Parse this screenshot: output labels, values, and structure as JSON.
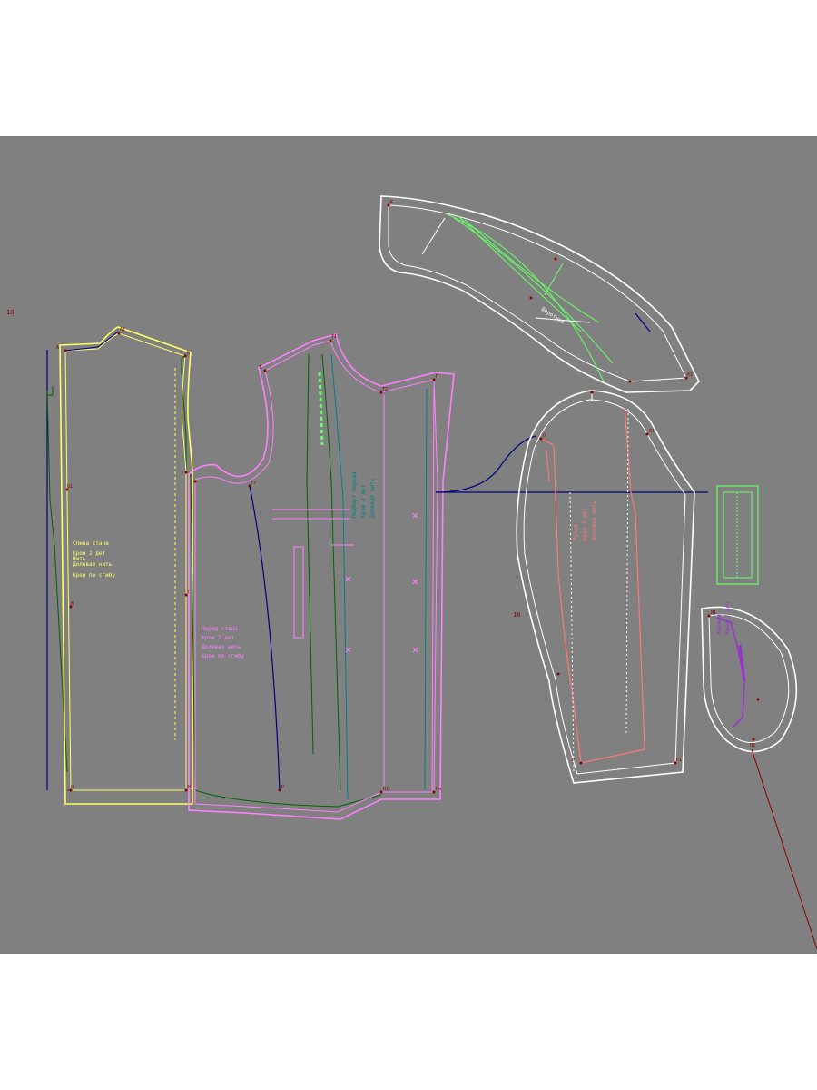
{
  "canvas": {
    "background": "#808080",
    "corner_label": "10",
    "sleeve_side_label": "10"
  },
  "colors": {
    "back": "#ffff66",
    "front": "#ff80ff",
    "sleeve": "#ff7777",
    "collar": "#66ff66",
    "small_piece": "#66ff66",
    "pocket": "#9933cc",
    "seam_white": "#ffffff",
    "construction_blue": "#000080",
    "construction_green": "#006400",
    "teal": "#008080",
    "point": "#8b0000"
  },
  "pieces": [
    {
      "name": "back",
      "icon": "pattern-piece-back",
      "text_lines": [
        "Спина стана",
        "Крои 2 дет",
        "Нить",
        "Долевая нить",
        "Крои по сгибу"
      ]
    },
    {
      "name": "front",
      "icon": "pattern-piece-front",
      "text_lines": [
        "Перед стана",
        "Крои 2 дет",
        "Долевая нить",
        "Крои по сгибу"
      ]
    },
    {
      "name": "front-facing",
      "icon": "pattern-piece-facing",
      "text_lines": [
        "Подборт переда",
        "Крои 2 дет",
        "Долевая нить"
      ]
    },
    {
      "name": "sleeve",
      "icon": "pattern-piece-sleeve",
      "text_lines": [
        "Рукав",
        "Крои 2 дет",
        "Долевая нить"
      ]
    },
    {
      "name": "collar",
      "icon": "pattern-piece-collar",
      "text_lines": [
        "Воротник"
      ]
    },
    {
      "name": "pocket",
      "icon": "pattern-piece-pocket",
      "text_lines": [
        "Карман",
        "Крои 2 дет"
      ]
    }
  ],
  "point_labels": [
    "A",
    "A1",
    "Б",
    "Б1",
    "В",
    "В1",
    "Г",
    "Гг",
    "Гт",
    "Т",
    "У1",
    "Т2",
    "Т1",
    "П",
    "П1",
    "П2",
    "Н",
    "Н1",
    "Нн",
    "Р",
    "Р1",
    "О",
    "О1",
    "К",
    "И1",
    "ГВ1",
    "X"
  ]
}
